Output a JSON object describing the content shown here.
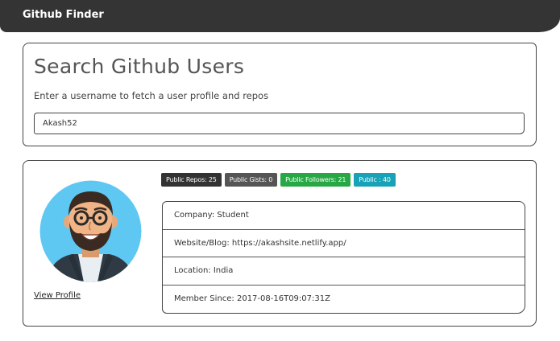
{
  "navbar": {
    "brand": "Github Finder"
  },
  "search": {
    "title": "Search Github Users",
    "subtitle": "Enter a username to fetch a user profile and repos",
    "input_value": "Akash52"
  },
  "profile": {
    "view_profile": "View Profile",
    "badges": {
      "repos": "Public Repos: 25",
      "gists": "Public Gists: 0",
      "followers": "Public Followers: 21",
      "following": "Public : 40"
    },
    "details": {
      "company": "Company: Student",
      "website": "Website/Blog: https://akashsite.netlify.app/",
      "location": "Location: India",
      "member_since": "Member Since: 2017-08-16T09:07:31Z"
    }
  },
  "colors": {
    "navbar": "#343434",
    "badge_dark": "#333333",
    "badge_secondary": "#555555",
    "badge_success": "#27a845",
    "badge_info": "#17a2b8",
    "avatar_bg": "#5ec8f2"
  }
}
